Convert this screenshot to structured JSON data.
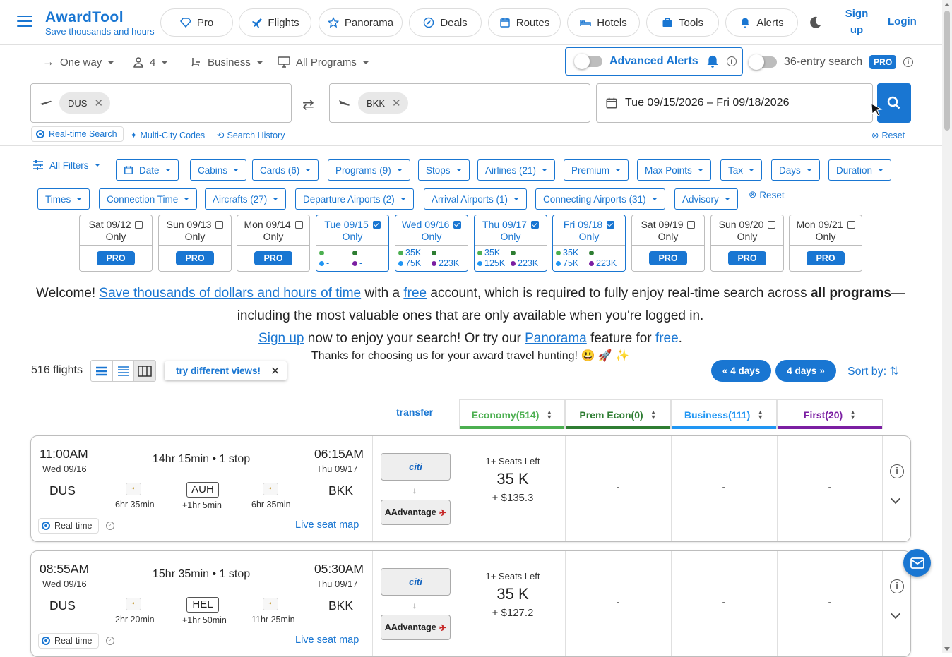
{
  "header": {
    "logo_title": "AwardTool",
    "logo_subtitle": "Save thousands and hours",
    "nav": [
      "Pro",
      "Flights",
      "Panorama",
      "Deals",
      "Routes",
      "Hotels",
      "Tools",
      "Alerts"
    ],
    "signup": "Sign up",
    "login": "Login"
  },
  "search": {
    "trip_type": "One way",
    "passengers": "4",
    "cabin": "Business",
    "programs": "All Programs",
    "advanced_alerts": "Advanced Alerts",
    "entry_search": "36-entry search",
    "pro": "PRO",
    "origin": "DUS",
    "destination": "BKK",
    "date_range": "Tue 09/15/2026 – Fri 09/18/2026",
    "realtime": "Real-time Search",
    "multicity": "Multi-City Codes",
    "history": "Search History",
    "reset": "Reset"
  },
  "filters": {
    "all": "All Filters",
    "chips": [
      "Date",
      "Cabins",
      "Cards (6)",
      "Programs (9)",
      "Stops",
      "Airlines (21)",
      "Premium",
      "Max Points",
      "Tax",
      "Days",
      "Duration",
      "Times",
      "Connection Time",
      "Aircrafts (27)",
      "Departure Airports (2)",
      "Arrival Airports (1)",
      "Connecting Airports (31)",
      "Advisory"
    ],
    "reset": "Reset"
  },
  "days": [
    {
      "date": "Sat 09/12",
      "only": "Only",
      "selected": false,
      "pro": "PRO"
    },
    {
      "date": "Sun 09/13",
      "only": "Only",
      "selected": false,
      "pro": "PRO"
    },
    {
      "date": "Mon 09/14",
      "only": "Only",
      "selected": false,
      "pro": "PRO"
    },
    {
      "date": "Tue 09/15",
      "only": "Only",
      "selected": true,
      "vals": [
        "-",
        "-",
        "-",
        "-"
      ]
    },
    {
      "date": "Wed 09/16",
      "only": "Only",
      "selected": true,
      "vals": [
        "35K",
        "-",
        "75K",
        "223K"
      ]
    },
    {
      "date": "Thu 09/17",
      "only": "Only",
      "selected": true,
      "vals": [
        "35K",
        "-",
        "125K",
        "223K"
      ]
    },
    {
      "date": "Fri 09/18",
      "only": "Only",
      "selected": true,
      "vals": [
        "35K",
        "-",
        "75K",
        "223K"
      ]
    },
    {
      "date": "Sat 09/19",
      "only": "Only",
      "selected": false,
      "pro": "PRO"
    },
    {
      "date": "Sun 09/20",
      "only": "Only",
      "selected": false,
      "pro": "PRO"
    },
    {
      "date": "Mon 09/21",
      "only": "Only",
      "selected": false,
      "pro": "PRO"
    }
  ],
  "welcome": {
    "p1": "Welcome! ",
    "link1": "Save thousands of dollars and hours of time",
    "p2": " with a ",
    "link2": "free",
    "p3": " account, which is required to fully enjoy real-time search across ",
    "bold": "all programs",
    "p4": "—including the most valuable ones that are only available when you're logged in.",
    "link3": "Sign up",
    "p5": " now to enjoy your search! Or try our ",
    "link4": "Panorama",
    "p6": " feature for ",
    "free": "free",
    "p7": ".",
    "thanks": "Thanks for choosing us for your award travel hunting! 😃 🚀 ✨"
  },
  "results": {
    "count": "516 flights",
    "tip": "try different views!",
    "prev": "4 days",
    "next": "4 days",
    "sort": "Sort by:",
    "transfer": "transfer",
    "cabins": [
      {
        "label": "Economy(514)",
        "color": "#4caf50"
      },
      {
        "label": "Prem Econ(0)",
        "color": "#2e7d32"
      },
      {
        "label": "Business(111)",
        "color": "#2196f3"
      },
      {
        "label": "First(20)",
        "color": "#7b1fa2"
      }
    ]
  },
  "flights": [
    {
      "dep_time": "11:00AM",
      "dep_date": "Wed 09/16",
      "arr_time": "06:15AM",
      "arr_date": "Thu 09/17",
      "duration": "14hr 15min • 1 stop",
      "from": "DUS",
      "to": "BKK",
      "hub": "AUH",
      "leg1": "6hr 35min",
      "layover": "+1hr 5min",
      "leg2": "6hr 35min",
      "realtime": "Real-time",
      "seatmap": "Live seat map",
      "card": "citi",
      "program": "AAdvantage",
      "seats": "1+ Seats Left",
      "points": "35 K",
      "tax": "+ $135.3",
      "prem": "-",
      "business": "-",
      "first": "-"
    },
    {
      "dep_time": "08:55AM",
      "dep_date": "Wed 09/16",
      "arr_time": "05:30AM",
      "arr_date": "Thu 09/17",
      "duration": "15hr 35min • 1 stop",
      "from": "DUS",
      "to": "BKK",
      "hub": "HEL",
      "leg1": "2hr 20min",
      "layover": "+1hr 50min",
      "leg2": "11hr 25min",
      "realtime": "Real-time",
      "seatmap": "Live seat map",
      "card": "citi",
      "program": "AAdvantage",
      "seats": "1+ Seats Left",
      "points": "35 K",
      "tax": "+ $127.2",
      "prem": "-",
      "business": "-",
      "first": "-"
    }
  ]
}
